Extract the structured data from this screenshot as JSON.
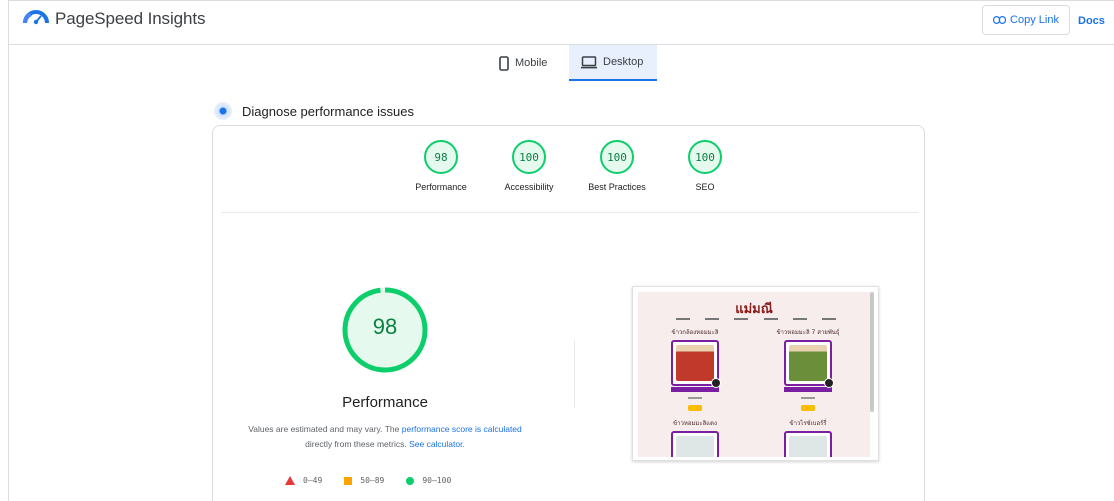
{
  "header": {
    "app_title": "PageSpeed Insights",
    "copy_link_label": "Copy Link",
    "docs_label": "Docs"
  },
  "tabs": [
    {
      "label": "Mobile",
      "icon": "smartphone-icon",
      "selected": false
    },
    {
      "label": "Desktop",
      "icon": "laptop-icon",
      "selected": true
    }
  ],
  "diagnose": {
    "title": "Diagnose performance issues"
  },
  "category_gauges": [
    {
      "score": "98",
      "label": "Performance"
    },
    {
      "score": "100",
      "label": "Accessibility"
    },
    {
      "score": "100",
      "label": "Best Practices"
    },
    {
      "score": "100",
      "label": "SEO"
    }
  ],
  "performance": {
    "score": "98",
    "score_fraction": 0.98,
    "title": "Performance",
    "note_prefix": "Values are estimated and may vary. The ",
    "note_link": "performance score is calculated",
    "note_middle": " directly from these metrics. ",
    "note_calc_link": "See calculator."
  },
  "legend": [
    {
      "range": "0–49",
      "shape": "triangle",
      "color": "#e53935"
    },
    {
      "range": "50–89",
      "shape": "square",
      "color": "#ffa400"
    },
    {
      "range": "90–100",
      "shape": "circle",
      "color": "#0cce6b"
    }
  ],
  "thumbnail": {
    "brand": "แม่มณี",
    "products": [
      {
        "name": "ข้าวกล้องหอมมะลิ",
        "pkg_color": "#c0392b"
      },
      {
        "name": "ข้าวหอมมะลิ 7 สายพันธุ์",
        "pkg_color": "#6a8e3a"
      },
      {
        "name": "ข้าวหอมมะลิแดง",
        "pkg_color": "#dfe6e6"
      },
      {
        "name": "ข้าวไรซ์เบอร์รี่",
        "pkg_color": "#dfe6e6"
      }
    ]
  },
  "colors": {
    "accent": "#1a73e8",
    "pass_green": "#0cce6b",
    "pass_text": "#0a8043",
    "pass_fill": "#e6f9ee"
  }
}
